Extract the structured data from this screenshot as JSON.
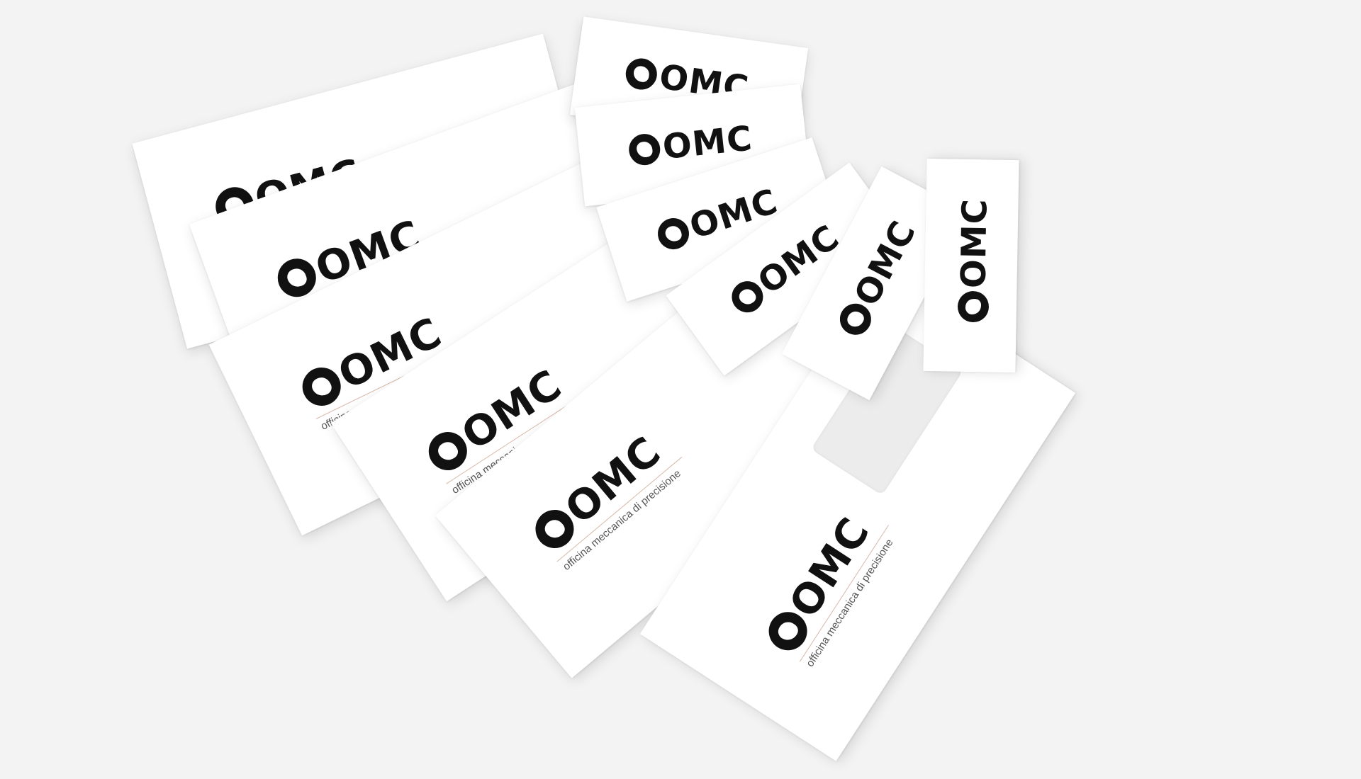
{
  "brand": {
    "logo_text": "OMC",
    "tagline": "officina meccanica di precisione"
  },
  "colors": {
    "background": "#f3f3f3",
    "paper": "#ffffff",
    "ink": "#111111",
    "rule_accent": "#d9b8a8"
  },
  "items": {
    "envelopes": 6,
    "business_cards": 6
  },
  "icons": [
    "gear-icon",
    "bell-icon",
    "hand-icon",
    "flower-icon",
    "hammer-icon",
    "nut-icon"
  ]
}
